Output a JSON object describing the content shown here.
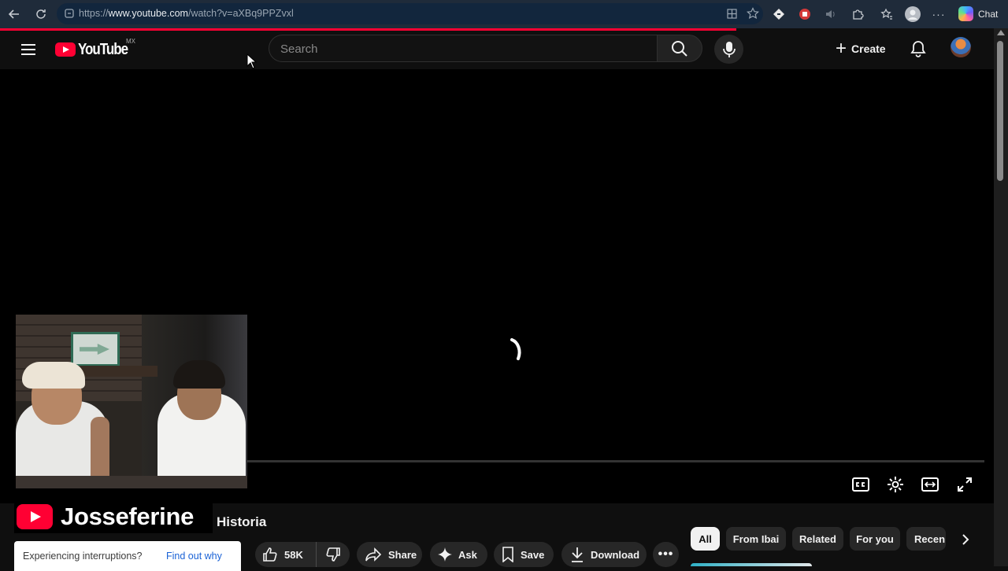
{
  "browser": {
    "url_prefix": "https://",
    "url_domain": "www.youtube.com",
    "url_path": "/watch?v=aXBq9PPZvxl",
    "chat_label": "Chat"
  },
  "header": {
    "logo_text": "YouTube",
    "country_code": "MX",
    "search_placeholder": "Search",
    "create_label": "Create"
  },
  "overlay": {
    "channel_name": "Josseferine",
    "title_visible": "Historia"
  },
  "notice": {
    "text": "Experiencing interruptions?",
    "link": "Find out why"
  },
  "actions": {
    "like_count": "58K",
    "share_label": "Share",
    "ask_label": "Ask",
    "save_label": "Save",
    "download_label": "Download"
  },
  "chips": [
    "All",
    "From Ibai",
    "Related",
    "For you",
    "Recen"
  ],
  "colors": {
    "brand_red": "#ff0033",
    "background": "#0f0f0f",
    "link_blue": "#1a62d6"
  }
}
